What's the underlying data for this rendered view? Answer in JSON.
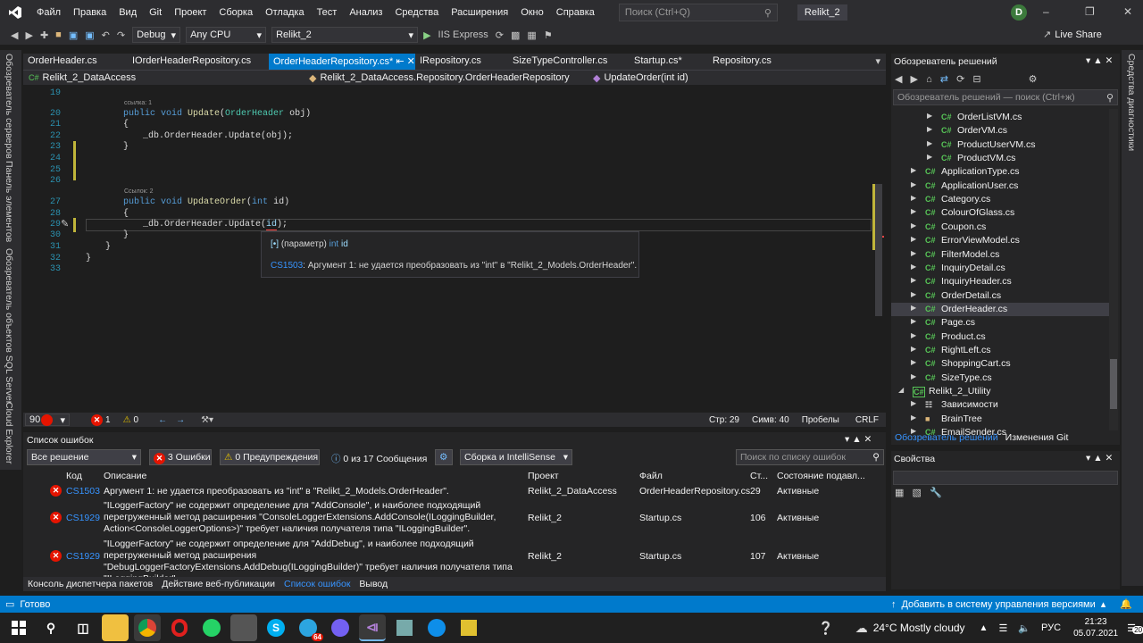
{
  "menu": [
    "Файл",
    "Правка",
    "Вид",
    "Git",
    "Проект",
    "Сборка",
    "Отладка",
    "Тест",
    "Анализ",
    "Средства",
    "Расширения",
    "Окно",
    "Справка"
  ],
  "search_placeholder": "Поиск (Ctrl+Q)",
  "solution_title": "Relikt_2",
  "user_initial": "D",
  "toolbar": {
    "config": "Debug",
    "platform": "Any CPU",
    "project": "Relikt_2",
    "run": "IIS Express",
    "live_share": "Live Share"
  },
  "side_tabs_left": [
    "Обозреватель серверов",
    "Панель элементов",
    "Обозреватель объектов SQL Server",
    "Cloud Explorer"
  ],
  "side_tab_right": "Средства диагностики",
  "tabs": [
    {
      "label": "OrderHeader.cs",
      "active": false
    },
    {
      "label": "IOrderHeaderRepository.cs",
      "active": false
    },
    {
      "label": "OrderHeaderRepository.cs*",
      "active": true
    },
    {
      "label": "IRepository.cs",
      "active": false
    },
    {
      "label": "SizeTypeController.cs",
      "active": false
    },
    {
      "label": "Startup.cs*",
      "active": false
    },
    {
      "label": "Repository.cs",
      "active": false
    }
  ],
  "nav": {
    "project": "Relikt_2_DataAccess",
    "class": "Relikt_2_DataAccess.Repository.OrderHeaderRepository",
    "member": "UpdateOrder(int id)"
  },
  "code": {
    "line_numbers": [
      "19",
      "20",
      "21",
      "22",
      "23",
      "24",
      "25",
      "26",
      "27",
      "28",
      "29",
      "30",
      "31",
      "32",
      "33"
    ],
    "ref1": "ссылка: 1",
    "ref2": "Ссылок: 2",
    "l20_kw": "public void ",
    "l20_fn": "Update",
    "l20_p1": "(",
    "l20_ty": "OrderHeader",
    "l20_p2": " obj)",
    "l21": "{",
    "l22": "_db.OrderHeader.Update(obj);",
    "l23": "}",
    "l27_kw": "public void ",
    "l27_fn": "UpdateOrder",
    "l27_p1": "(",
    "l27_kw2": "int",
    "l27_p2": " id)",
    "l28": "{",
    "l29_a": "_db.OrderHeader.Update(",
    "l29_b": "id",
    "l29_c": ");",
    "l30": "}",
    "l31": "}",
    "l32": "}"
  },
  "tooltip": {
    "param_label": "(параметр)",
    "param_type": "int",
    "param_name": "id",
    "code": "CS1503",
    "message": ": Аргумент 1: не удается преобразовать из \"int\" в \"Relikt_2_Models.OrderHeader\"."
  },
  "editor_status": {
    "zoom": "90 %",
    "errors": "1",
    "warnings": "0",
    "line": "Стр: 29",
    "col": "Симв: 40",
    "spaces": "Пробелы",
    "eol": "CRLF"
  },
  "solution_explorer": {
    "title": "Обозреватель решений",
    "search_placeholder": "Обозреватель решений — поиск (Ctrl+ж)",
    "items": [
      {
        "label": "OrderListVM.cs",
        "indent": 3
      },
      {
        "label": "OrderVM.cs",
        "indent": 3
      },
      {
        "label": "ProductUserVM.cs",
        "indent": 3
      },
      {
        "label": "ProductVM.cs",
        "indent": 3
      },
      {
        "label": "ApplicationType.cs",
        "indent": 2
      },
      {
        "label": "ApplicationUser.cs",
        "indent": 2
      },
      {
        "label": "Category.cs",
        "indent": 2
      },
      {
        "label": "ColourOfGlass.cs",
        "indent": 2
      },
      {
        "label": "Coupon.cs",
        "indent": 2
      },
      {
        "label": "ErrorViewModel.cs",
        "indent": 2
      },
      {
        "label": "FilterModel.cs",
        "indent": 2
      },
      {
        "label": "InquiryDetail.cs",
        "indent": 2
      },
      {
        "label": "InquiryHeader.cs",
        "indent": 2
      },
      {
        "label": "OrderDetail.cs",
        "indent": 2
      },
      {
        "label": "OrderHeader.cs",
        "indent": 2,
        "selected": true
      },
      {
        "label": "Page.cs",
        "indent": 2
      },
      {
        "label": "Product.cs",
        "indent": 2
      },
      {
        "label": "RightLeft.cs",
        "indent": 2
      },
      {
        "label": "ShoppingCart.cs",
        "indent": 2
      },
      {
        "label": "SizeType.cs",
        "indent": 2
      },
      {
        "label": "Relikt_2_Utility",
        "indent": 1
      },
      {
        "label": "Зависимости",
        "indent": 2
      },
      {
        "label": "BrainTree",
        "indent": 2
      },
      {
        "label": "EmailSender.cs",
        "indent": 2
      }
    ],
    "tab_active": "Обозреватель решений",
    "tab_other": "Изменения Git"
  },
  "properties_title": "Свойства",
  "error_list": {
    "title": "Список ошибок",
    "scope": "Все решение",
    "errors_btn": "3 Ошибки",
    "warnings_btn": "0 Предупреждения",
    "messages_btn": "0 из 17 Сообщения",
    "build_filter": "Сборка и IntelliSense",
    "search_placeholder": "Поиск по списку ошибок",
    "columns": [
      "Код",
      "Описание",
      "Проект",
      "Файл",
      "Ст...",
      "Состояние подавл..."
    ],
    "rows": [
      {
        "code": "CS1503",
        "desc": "Аргумент 1: не удается преобразовать из \"int\" в \"Relikt_2_Models.OrderHeader\".",
        "project": "Relikt_2_DataAccess",
        "file": "OrderHeaderRepository.cs",
        "line": "29",
        "state": "Активные"
      },
      {
        "code": "CS1929",
        "desc": "\"ILoggerFactory\" не содержит определение для \"AddConsole\", и наиболее подходящий перегруженный метод расширения \"ConsoleLoggerExtensions.AddConsole(ILoggingBuilder, Action<ConsoleLoggerOptions>)\" требует наличия получателя типа \"ILoggingBuilder\".",
        "project": "Relikt_2",
        "file": "Startup.cs",
        "line": "106",
        "state": "Активные"
      },
      {
        "code": "CS1929",
        "desc": "\"ILoggerFactory\" не содержит определение для \"AddDebug\", и наиболее подходящий перегруженный метод расширения \"DebugLoggerFactoryExtensions.AddDebug(ILoggingBuilder)\" требует наличия получателя типа \"ILoggingBuilder\".",
        "project": "Relikt_2",
        "file": "Startup.cs",
        "line": "107",
        "state": "Активные"
      }
    ]
  },
  "bottom_tabs": [
    {
      "label": "Консоль диспетчера пакетов",
      "active": false
    },
    {
      "label": "Действие веб-публикации",
      "active": false
    },
    {
      "label": "Список ошибок",
      "active": true
    },
    {
      "label": "Вывод",
      "active": false
    }
  ],
  "statusbar": {
    "ready": "Готово",
    "vcs": "Добавить в систему управления версиями"
  },
  "taskbar": {
    "weather": "24°C  Mostly cloudy",
    "lang": "РУС",
    "time": "21:23",
    "date": "05.07.2021",
    "notif": "20",
    "badge_telegram": "64"
  }
}
